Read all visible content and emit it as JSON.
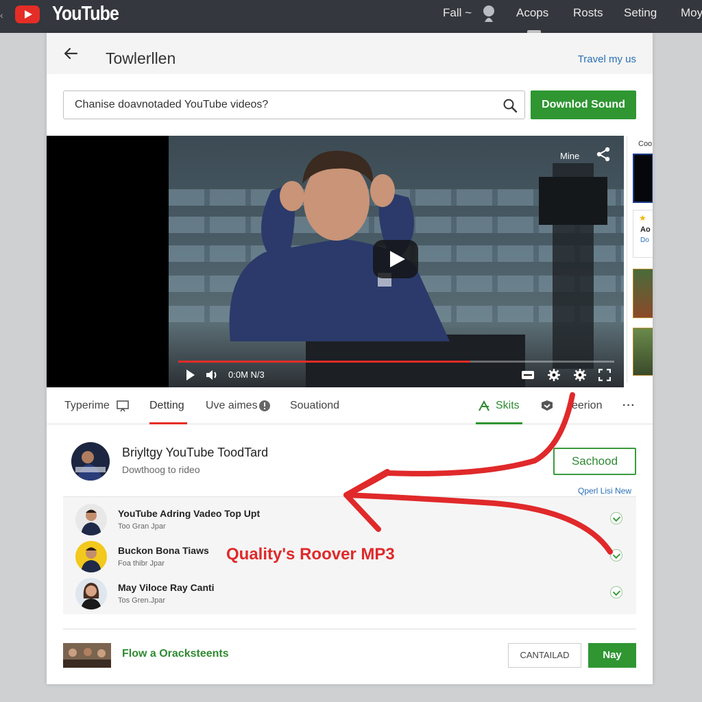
{
  "topbar": {
    "brand": "YouTube",
    "nav": [
      "Fall ~",
      "Acops",
      "Rosts",
      "Seting",
      "Moy"
    ]
  },
  "header": {
    "title": "Towlerllen",
    "link": "Travel my us"
  },
  "search": {
    "value": "Chanise doavnotaded YouTube videos?",
    "button": "Downlod Sound"
  },
  "video": {
    "overlay_label": "Mine",
    "time": "0:0M N/3",
    "progress": 0.67,
    "side_label": "Coo",
    "side_text1": "Ao",
    "side_text2": "Do"
  },
  "tabs": [
    {
      "label": "Typerime"
    },
    {
      "label": "Detting"
    },
    {
      "label": "Uve aimes"
    },
    {
      "label": "Souationd"
    },
    {
      "label": "Skits"
    },
    {
      "label": "eerion"
    }
  ],
  "channel": {
    "name": "Briyltgy YouTube ToodTard",
    "subtitle": "Dowthoog to rideo",
    "subscribe": "Sachood",
    "open_link": "Qperl Lisi New"
  },
  "list": [
    {
      "title": "YouTube Adring Vadeo Top Upt",
      "sub": "Too Gran Jpar"
    },
    {
      "title": "Buckon Bona Tiaws",
      "sub": "Foa thibr Jpar"
    },
    {
      "title": "May Viloce Ray Canti",
      "sub": "Tos Gren.Jpar"
    }
  ],
  "annotation": "Quality's Roover MP3",
  "footer": {
    "text": "Flow a Oracksteents",
    "cancel": "CANTAILAD",
    "ok": "Nay"
  },
  "colors": {
    "brand_red": "#e52d27",
    "accent_green": "#2f9632",
    "link_blue": "#2a6fb5"
  }
}
